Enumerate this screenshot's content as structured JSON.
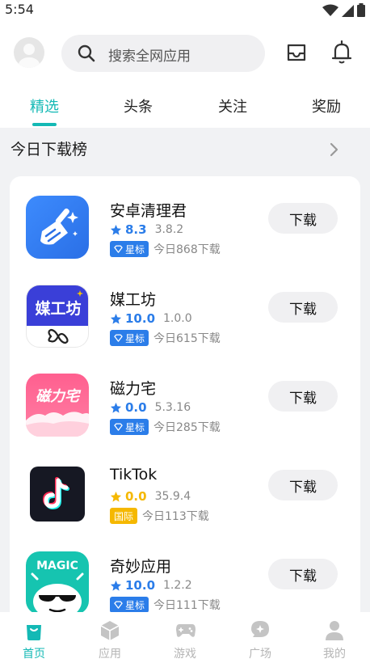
{
  "status_bar": {
    "time": "5:54"
  },
  "search": {
    "placeholder": "搜索全网应用"
  },
  "tabs": [
    {
      "label": "精选",
      "active": true
    },
    {
      "label": "头条",
      "active": false
    },
    {
      "label": "关注",
      "active": false
    },
    {
      "label": "奖励",
      "active": false
    }
  ],
  "section": {
    "title": "今日下载榜"
  },
  "apps": [
    {
      "name": "安卓清理君",
      "score": "8.3",
      "version": "3.8.2",
      "badge": "星标",
      "downloads": "今日868下载",
      "button": "下载"
    },
    {
      "name": "媒工坊",
      "score": "10.0",
      "version": "1.0.0",
      "badge": "星标",
      "downloads": "今日615下载",
      "button": "下载",
      "icon_text": "媒工坊"
    },
    {
      "name": "磁力宅",
      "score": "0.0",
      "version": "5.3.16",
      "badge": "星标",
      "downloads": "今日285下载",
      "button": "下载",
      "icon_text": "磁力宅"
    },
    {
      "name": "TikTok",
      "score": "0.0",
      "version": "35.9.4",
      "badge": "国际",
      "downloads": "今日113下载",
      "button": "下载"
    },
    {
      "name": "奇妙应用",
      "score": "10.0",
      "version": "1.2.2",
      "badge": "星标",
      "downloads": "今日111下载",
      "button": "下载",
      "icon_text": "MAGIC"
    }
  ],
  "bottom_nav": [
    {
      "label": "首页",
      "active": true
    },
    {
      "label": "应用",
      "active": false
    },
    {
      "label": "游戏",
      "active": false
    },
    {
      "label": "广场",
      "active": false
    },
    {
      "label": "我的",
      "active": false
    }
  ],
  "colors": {
    "accent": "#14b9b5",
    "star_blue": "#2b7de9",
    "star_gold": "#f5b800"
  }
}
